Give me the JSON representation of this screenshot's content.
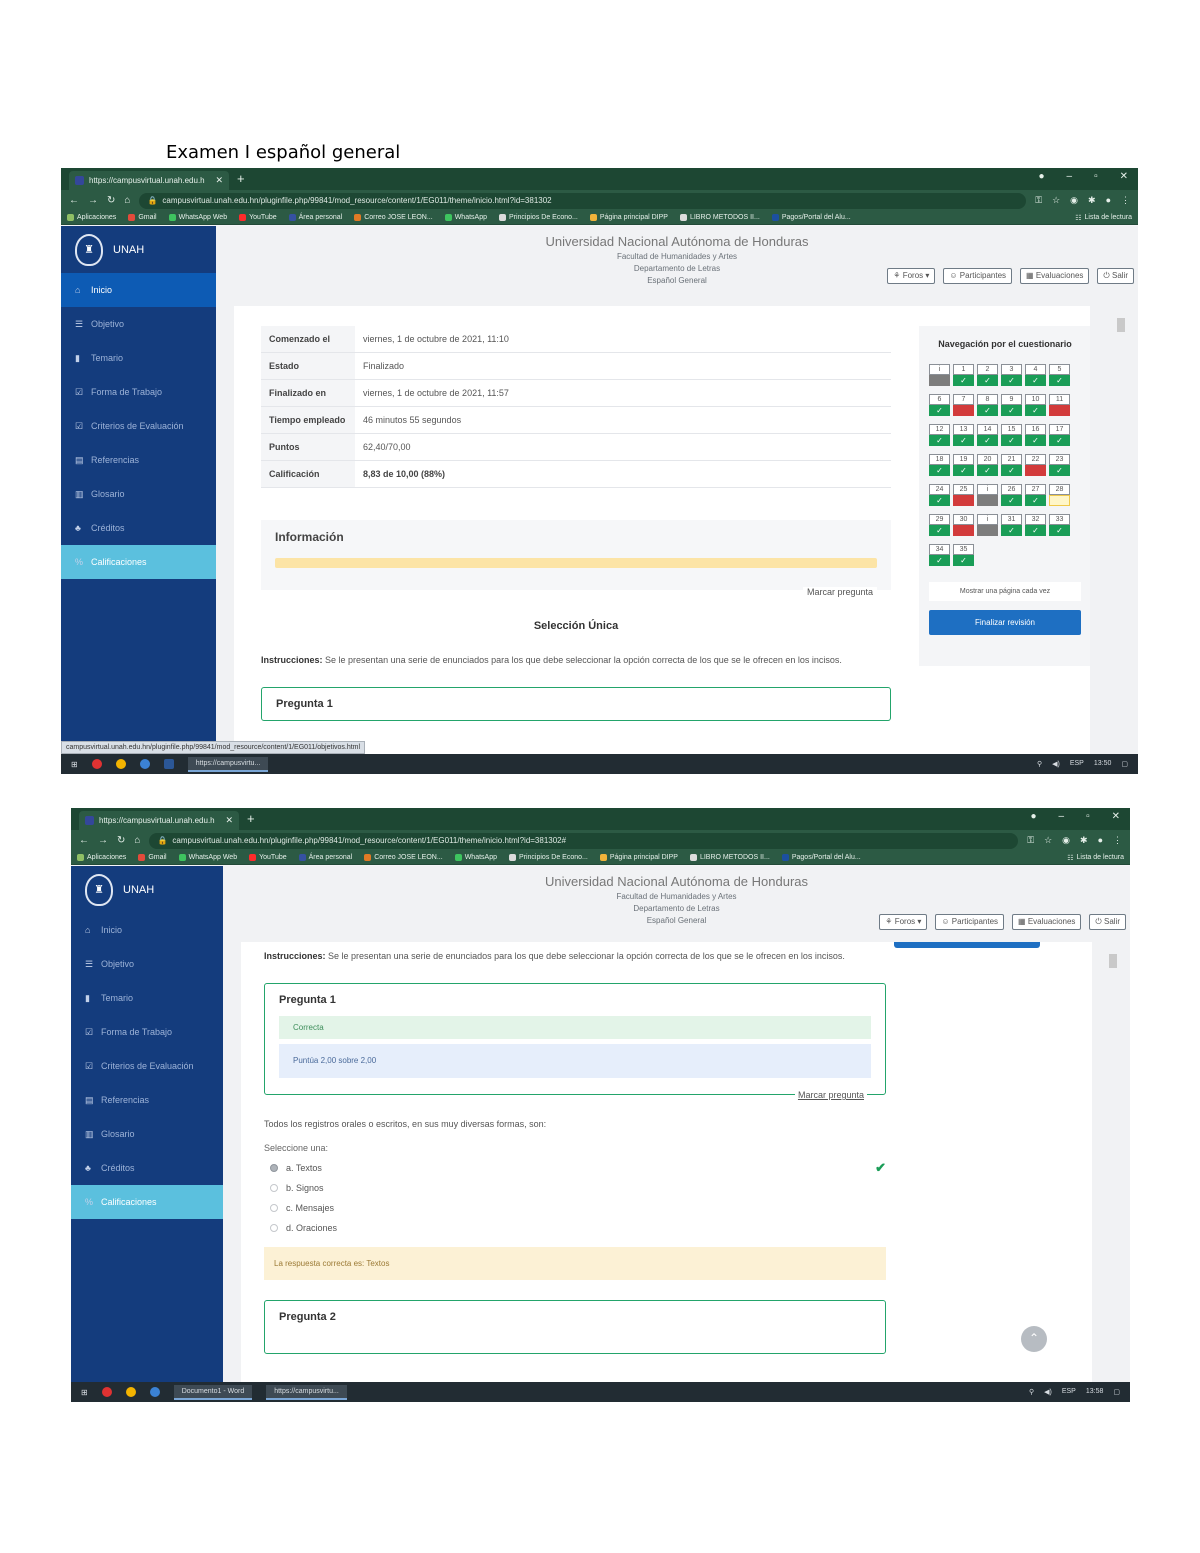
{
  "document_title": "Examen I español general",
  "browser": {
    "tab_title": "https://campusvirtual.unah.edu.h",
    "tab_title_2": "https://campusvirtual.unah.edu.h",
    "url": "campusvirtual.unah.edu.hn/pluginfile.php/99841/mod_resource/content/1/EG011/theme/inicio.html?id=381302",
    "url_2": "campusvirtual.unah.edu.hn/pluginfile.php/99841/mod_resource/content/1/EG011/theme/inicio.html?id=381302#",
    "bookmarks": [
      "Aplicaciones",
      "Gmail",
      "WhatsApp Web",
      "YouTube",
      "Área personal",
      "Correo JOSE LEON...",
      "WhatsApp",
      "Principios De Econo...",
      "Página principal DIPP",
      "LIBRO METODOS II...",
      "Pagos/Portal del Alu..."
    ],
    "reading_list": "Lista de lectura"
  },
  "sidebar": {
    "brand": "UNAH",
    "items": [
      "Inicio",
      "Objetivo",
      "Temario",
      "Forma de Trabajo",
      "Criterios de Evaluación",
      "Referencias",
      "Glosario",
      "Créditos",
      "Calificaciones"
    ]
  },
  "header": {
    "university": "Universidad Nacional Autónoma de Honduras",
    "faculty": "Facultad de Humanidades y Artes",
    "department": "Departamento de Letras",
    "course": "Español General",
    "buttons": [
      "Foros",
      "Participantes",
      "Evaluaciones",
      "Salir"
    ]
  },
  "summary": {
    "rows": [
      {
        "label": "Comenzado el",
        "value": "viernes, 1 de octubre de 2021, 11:10"
      },
      {
        "label": "Estado",
        "value": "Finalizado"
      },
      {
        "label": "Finalizado en",
        "value": "viernes, 1 de octubre de 2021, 11:57"
      },
      {
        "label": "Tiempo empleado",
        "value": "46 minutos 55 segundos"
      },
      {
        "label": "Puntos",
        "value": "62,40/70,00"
      },
      {
        "label": "Calificación",
        "value": "8,83 de 10,00 (88%)"
      }
    ]
  },
  "info": {
    "title": "Información",
    "flag": "Marcar pregunta"
  },
  "section": {
    "title": "Selección Única",
    "instructions_label": "Instrucciones:",
    "instructions_text": "Se le presentan una serie de enunciados para los que debe seleccionar la opción correcta de los que se le ofrecen en los incisos."
  },
  "quiz_nav": {
    "title": "Navegación por el cuestionario",
    "questions": [
      {
        "n": "i",
        "s": "n"
      },
      {
        "n": "1",
        "s": "c"
      },
      {
        "n": "2",
        "s": "c"
      },
      {
        "n": "3",
        "s": "c"
      },
      {
        "n": "4",
        "s": "c"
      },
      {
        "n": "5",
        "s": "c"
      },
      {
        "n": "6",
        "s": "c"
      },
      {
        "n": "7",
        "s": "w"
      },
      {
        "n": "8",
        "s": "c"
      },
      {
        "n": "9",
        "s": "c"
      },
      {
        "n": "10",
        "s": "c"
      },
      {
        "n": "11",
        "s": "w"
      },
      {
        "n": "12",
        "s": "c"
      },
      {
        "n": "13",
        "s": "c"
      },
      {
        "n": "14",
        "s": "c"
      },
      {
        "n": "15",
        "s": "c"
      },
      {
        "n": "16",
        "s": "c"
      },
      {
        "n": "17",
        "s": "c"
      },
      {
        "n": "18",
        "s": "c"
      },
      {
        "n": "19",
        "s": "c"
      },
      {
        "n": "20",
        "s": "c"
      },
      {
        "n": "21",
        "s": "c"
      },
      {
        "n": "22",
        "s": "w"
      },
      {
        "n": "23",
        "s": "c"
      },
      {
        "n": "24",
        "s": "c"
      },
      {
        "n": "25",
        "s": "w"
      },
      {
        "n": "i",
        "s": "n"
      },
      {
        "n": "26",
        "s": "c"
      },
      {
        "n": "27",
        "s": "c"
      },
      {
        "n": "28",
        "s": "f"
      },
      {
        "n": "29",
        "s": "c"
      },
      {
        "n": "30",
        "s": "w"
      },
      {
        "n": "i",
        "s": "n"
      },
      {
        "n": "31",
        "s": "c"
      },
      {
        "n": "32",
        "s": "c"
      },
      {
        "n": "33",
        "s": "c"
      },
      {
        "n": "34",
        "s": "c"
      },
      {
        "n": "35",
        "s": "c"
      }
    ],
    "show_one_page": "Mostrar una página cada vez",
    "finish": "Finalizar revisión"
  },
  "question1": {
    "title": "Pregunta 1",
    "state": "Correcta",
    "grade": "Puntúa 2,00 sobre 2,00",
    "flag": "Marcar pregunta",
    "text": "Todos los registros orales o escritos, en sus muy diversas formas, son:",
    "select_label": "Seleccione una:",
    "options": [
      "a. Textos",
      "b. Signos",
      "c. Mensajes",
      "d. Oraciones"
    ],
    "selected_index": 0,
    "correct_answer": "La respuesta correcta es: Textos"
  },
  "question2": {
    "title": "Pregunta 2"
  },
  "status_url": "campusvirtual.unah.edu.hn/pluginfile.php/99841/mod_resource/content/1/EG011/objetivos.html",
  "taskbar": {
    "app1": "https://campusvirtu...",
    "app_word": "Documento1 - Word",
    "app2": "https://campusvirtu...",
    "lang": "ESP",
    "time1": "13:50",
    "time2": "13:58"
  }
}
